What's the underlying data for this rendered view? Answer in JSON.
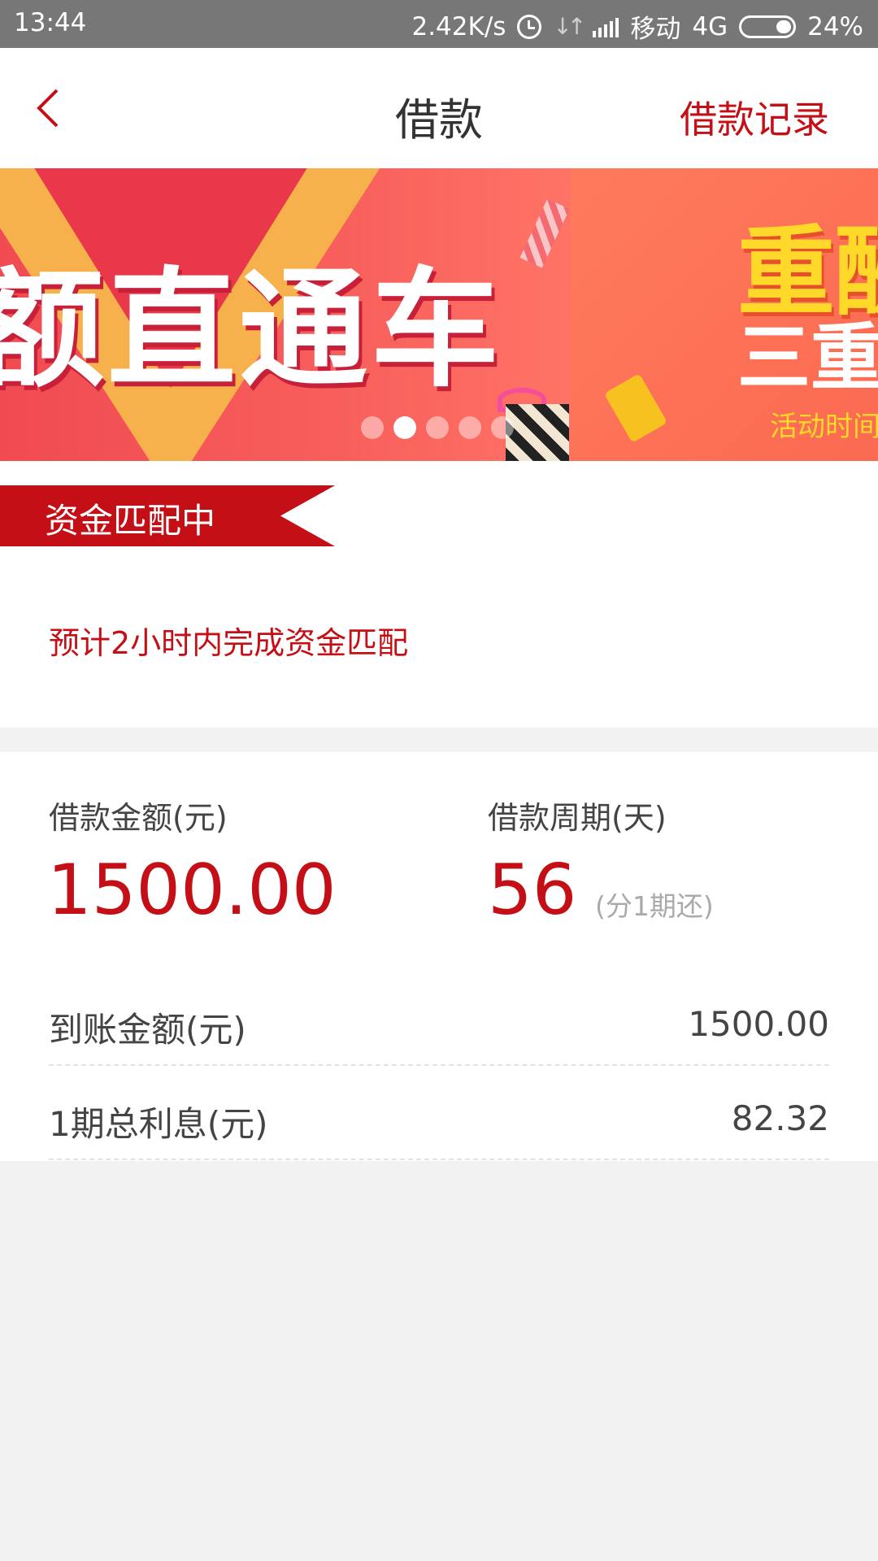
{
  "status_bar": {
    "time": "13:44",
    "net_speed": "2.42K/s",
    "carrier": "移动",
    "network": "4G",
    "battery_pct": "24%",
    "battery_level": 0.24
  },
  "nav": {
    "title": "借款",
    "record_label": "借款记录"
  },
  "banner": {
    "slide1_text": "额直通车",
    "slide2_line1": "重酬",
    "slide2_line2": "三重",
    "slide2_line3": "活动时间",
    "dot_count": 5,
    "active_dot": 1
  },
  "status": {
    "badge": "资金匹配中",
    "desc": "预计2小时内完成资金匹配"
  },
  "loan": {
    "amount_label": "借款金额(元)",
    "amount_value": "1500.00",
    "period_label": "借款周期(天)",
    "period_value": "56",
    "period_note": "(分1期还)",
    "rows": [
      {
        "label": "到账金额(元)",
        "value": "1500.00"
      },
      {
        "label": "1期总利息(元)",
        "value": "82.32"
      }
    ]
  },
  "colors": {
    "accent": "#c50f16",
    "status_bar_bg": "#777777",
    "page_bg": "#f2f2f2"
  }
}
